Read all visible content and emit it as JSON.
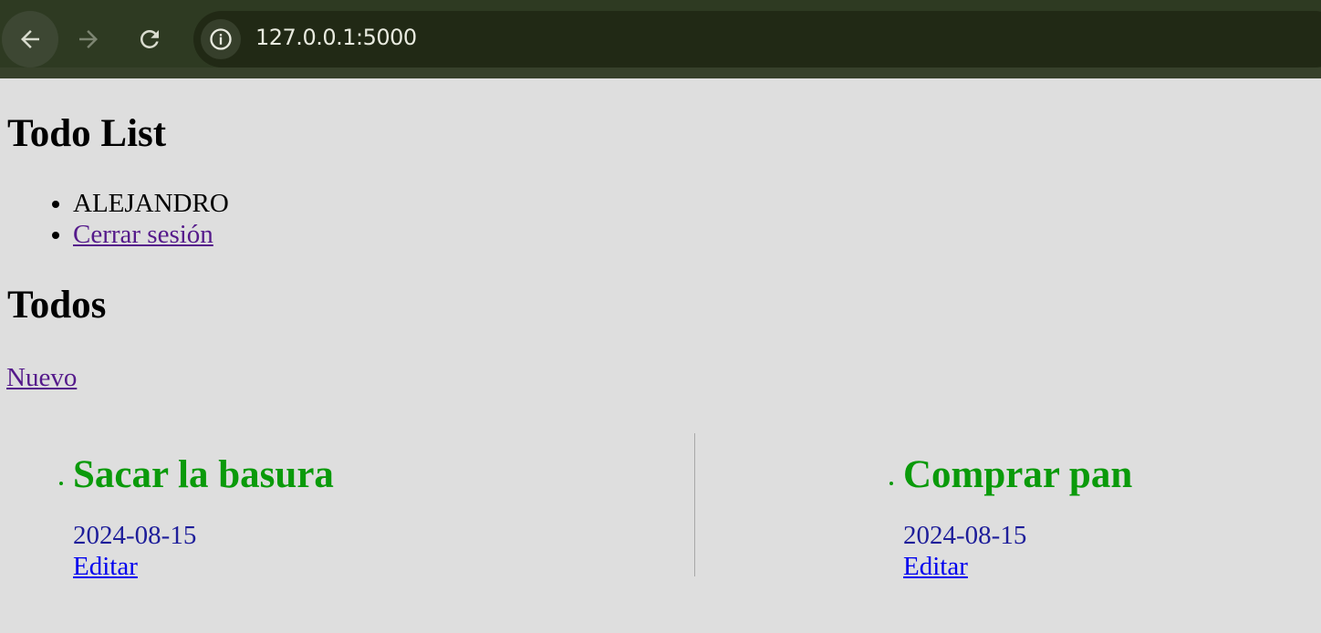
{
  "browser": {
    "url": "127.0.0.1:5000",
    "icons": [
      "back-arrow-icon",
      "forward-arrow-icon",
      "reload-icon",
      "info-icon"
    ]
  },
  "page": {
    "title": "Todo List",
    "user_items": [
      "ALEJANDRO",
      "Cerrar sesión"
    ],
    "section_title": "Todos",
    "new_link": "Nuevo"
  },
  "todos": [
    {
      "title": "Sacar la basura",
      "date": "2024-08-15",
      "edit_label": "Editar"
    },
    {
      "title": "Comprar pan",
      "date": "2024-08-15",
      "edit_label": "Editar"
    }
  ],
  "colors": {
    "todo_title": "#0a9a0a",
    "date_text": "#1e1e9a",
    "page_bg": "#dedede",
    "chrome_bg": "#2e3a22"
  }
}
